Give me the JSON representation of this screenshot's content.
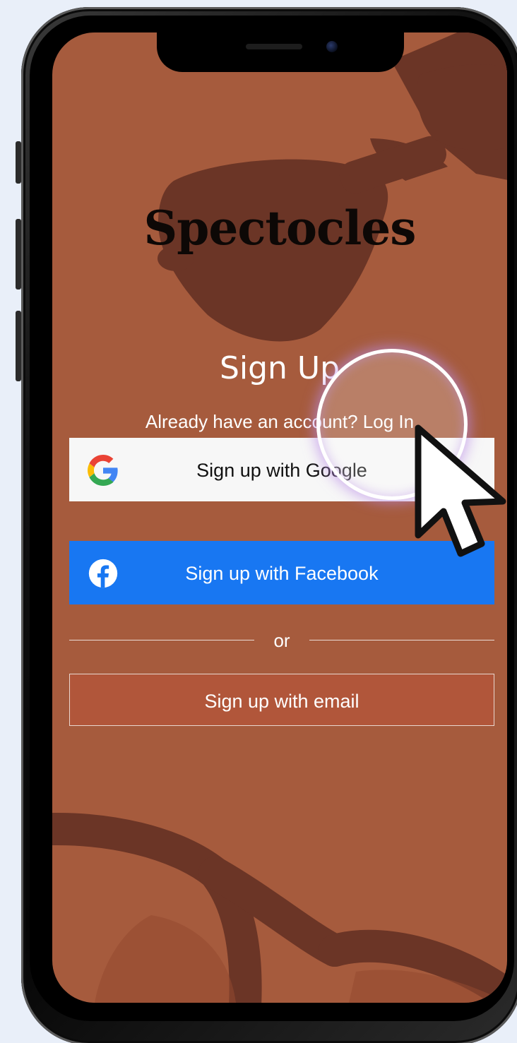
{
  "app": {
    "brand": "Spectocles"
  },
  "signup": {
    "title": "Sign Up",
    "login_prompt": "Already have an account? ",
    "login_link": "Log In",
    "google_label": "Sign up with Google",
    "facebook_label": "Sign up with Facebook",
    "divider_text": "or",
    "email_label": "Sign up with email"
  },
  "colors": {
    "background_rust": "#a65b3d",
    "glasses_shadow": "#6b3526",
    "email_button_fill": "#b1563a",
    "facebook_blue": "#1877f2",
    "google_button_fill": "#f7f7f7",
    "page_backdrop": "#e9eff9"
  },
  "icons": {
    "google": "google-g-icon",
    "facebook": "facebook-f-icon",
    "cursor": "mouse-pointer-icon"
  }
}
